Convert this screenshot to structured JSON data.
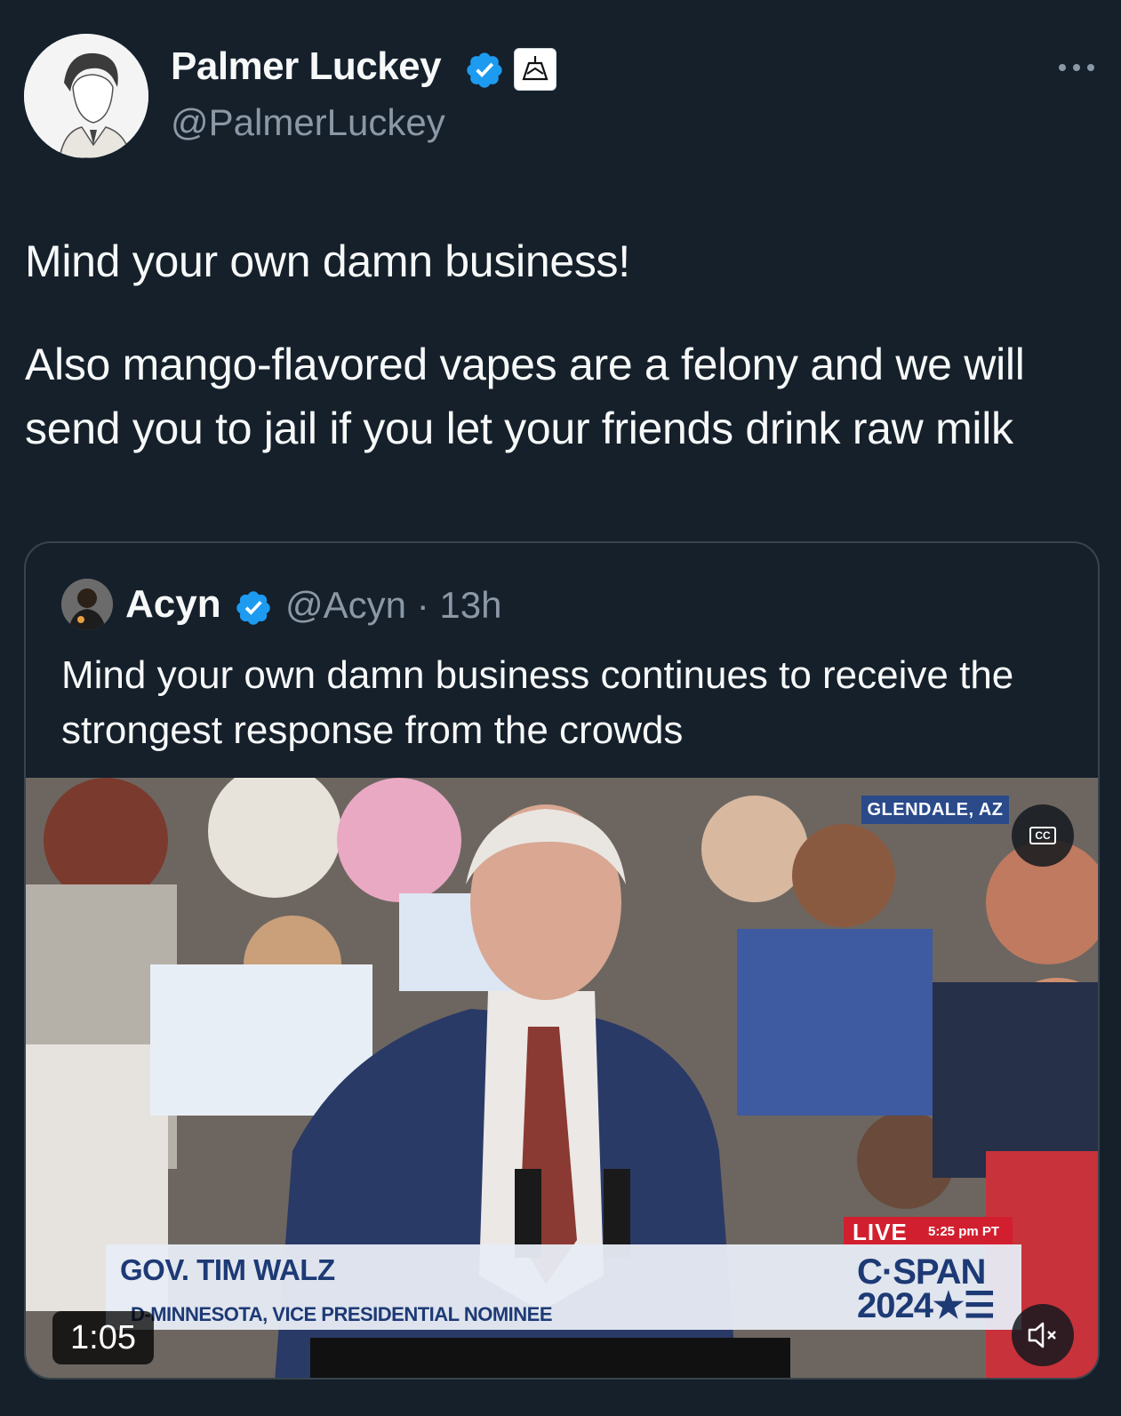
{
  "author": {
    "name": "Palmer Luckey",
    "handle": "@PalmerLuckey"
  },
  "tweet": {
    "paragraph1": "Mind your own damn business!",
    "paragraph2_line1": "Also mango-flavored vapes are a felony and we will",
    "paragraph2_line2": "send you to jail if you let your friends drink raw milk"
  },
  "quote": {
    "name": "Acyn",
    "handle": "@Acyn",
    "separator": "·",
    "time": "13h",
    "text": "Mind your own damn business continues to receive the strongest response from the crowds",
    "video": {
      "location": "GLENDALE, AZ",
      "cc_label": "CC",
      "chyron_name": "GOV. TIM WALZ",
      "chyron_subtitle": "D-MINNESOTA, VICE PRESIDENTIAL NOMINEE",
      "live_label": "LIVE",
      "live_time": "5:25 pm PT",
      "network_line1": "C·SPAN",
      "network_line2": "2024★☰",
      "duration": "1:05"
    }
  },
  "icons": {
    "verified": "verified-badge-icon",
    "affiliate": "affiliate-logo-icon",
    "more": "more-options-icon",
    "captions": "closed-captions-icon",
    "mute": "muted-speaker-icon"
  },
  "colors": {
    "background": "#15202b",
    "primary_text": "#f7f9f9",
    "secondary_text": "#8b98a5",
    "verified_blue": "#1d9bf0",
    "border": "#38444d"
  }
}
